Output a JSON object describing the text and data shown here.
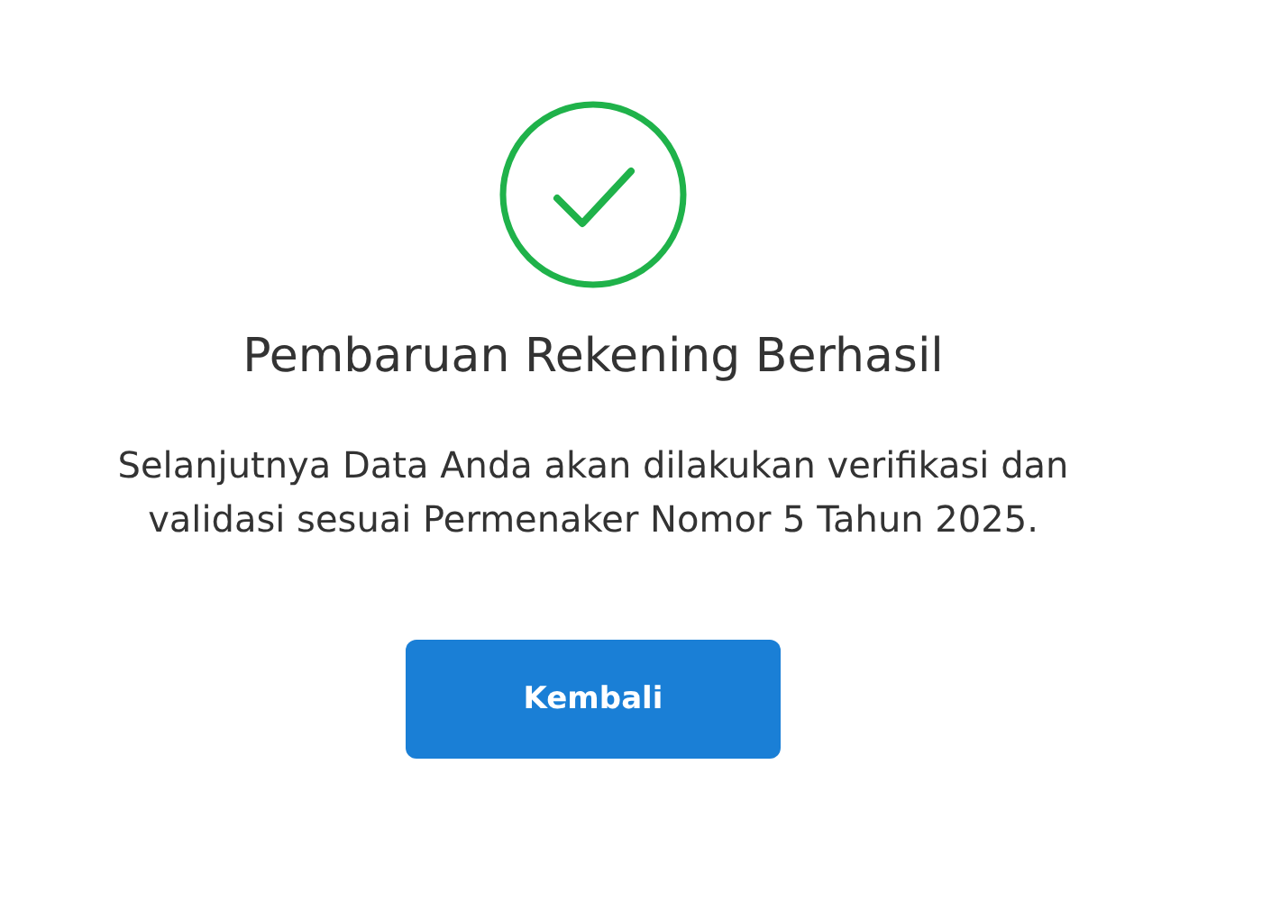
{
  "title": "Pembaruan Rekening Berhasil",
  "message": "Selanjutnya Data Anda akan dilakukan verifikasi dan validasi sesuai Permenaker Nomor 5 Tahun 2025.",
  "button": {
    "label": "Kembali"
  }
}
